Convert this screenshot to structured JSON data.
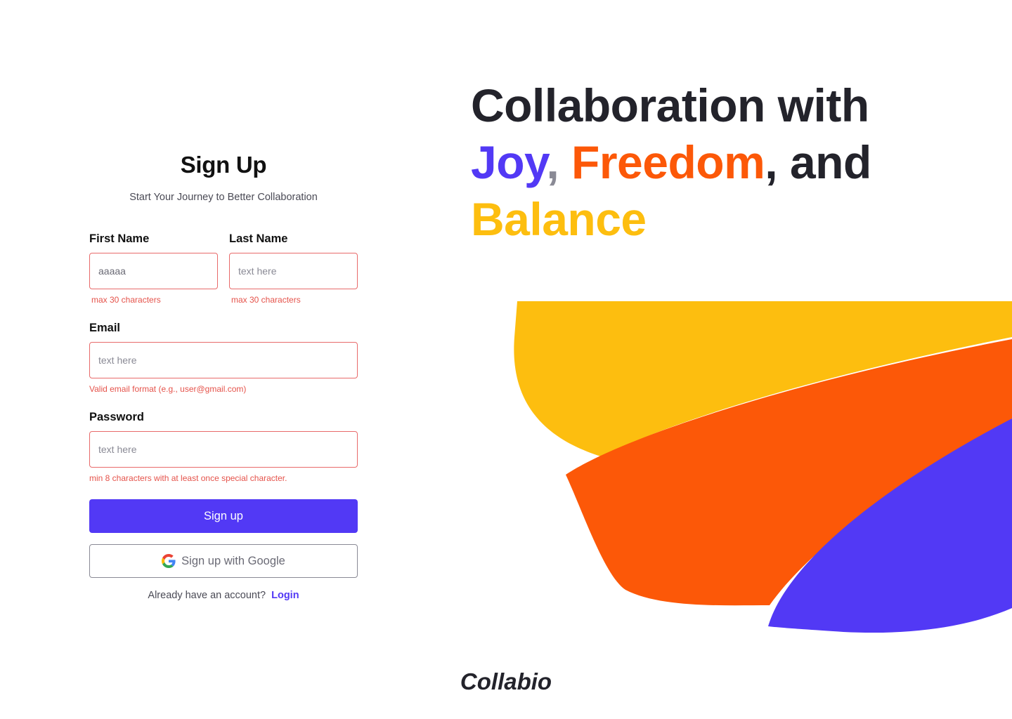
{
  "signup": {
    "title": "Sign Up",
    "subtitle": "Start Your Journey to Better Collaboration",
    "first_name": {
      "label": "First Name",
      "value": "aaaaa",
      "placeholder": "text here",
      "hint": "max 30 characters"
    },
    "last_name": {
      "label": "Last Name",
      "value": "",
      "placeholder": "text here",
      "hint": "max 30 characters"
    },
    "email": {
      "label": "Email",
      "value": "",
      "placeholder": "text here",
      "hint": "Valid email format (e.g., user@gmail.com)"
    },
    "password": {
      "label": "Password",
      "value": "",
      "placeholder": "text here",
      "hint": "min 8 characters with at least once special character."
    },
    "submit_label": "Sign up",
    "google_label": "Sign up with Google",
    "google_icon": "google-g-icon",
    "login_prompt": "Already have an account?",
    "login_label": "Login"
  },
  "hero": {
    "line1": "Collaboration with",
    "word_joy": "Joy",
    "comma1": ",",
    "word_freedom": "Freedom",
    "and_text": ", and",
    "word_balance": "Balance"
  },
  "brand": {
    "name": "Collabio"
  },
  "colors": {
    "primary": "#5239f5",
    "orange": "#fc5808",
    "yellow": "#fdbe0f",
    "error": "#e5534b",
    "text_dark": "#23232b"
  }
}
